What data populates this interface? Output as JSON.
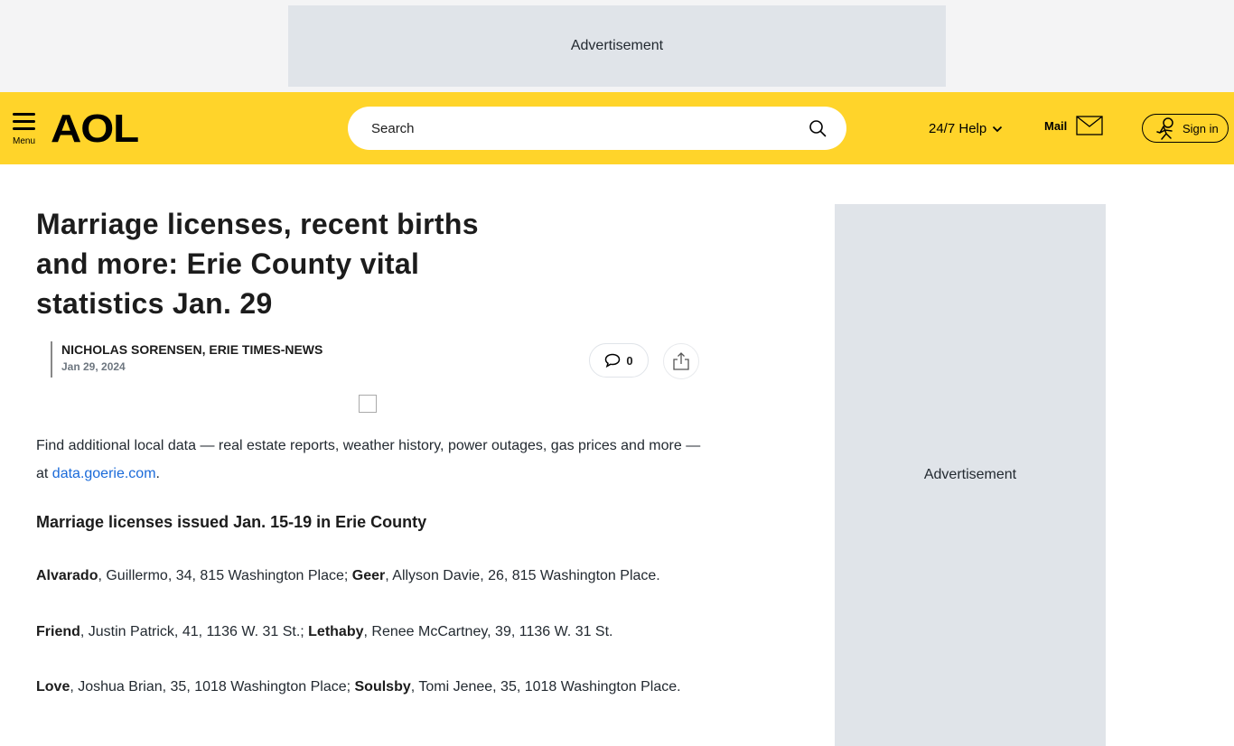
{
  "ads": {
    "top_label": "Advertisement",
    "side_label": "Advertisement"
  },
  "header": {
    "menu_label": "Menu",
    "logo_text": "AOL",
    "search_placeholder": "Search",
    "help_label": "24/7 Help",
    "mail_label": "Mail",
    "signin_label": "Sign in",
    "background_color": "#ffd42a"
  },
  "article": {
    "title": "Marriage licenses, recent births and more: Erie County vital statistics Jan. 29",
    "author": "NICHOLAS SORENSEN, ERIE TIMES-NEWS",
    "date": "Jan 29, 2024",
    "comment_count": "0",
    "intro_before_link": "Find additional local data — real estate reports, weather history, power outages, gas prices and more — at ",
    "intro_link": "data.goerie.com",
    "intro_after_link": ".",
    "subhead": "Marriage licenses issued Jan. 15-19 in Erie County",
    "licenses": [
      {
        "name1": "Alvarado",
        "rest1": ", Guillermo, 34, 815 Washington Place; ",
        "name2": "Geer",
        "rest2": ", Allyson Davie, 26, 815 Washington Place."
      },
      {
        "name1": "Friend",
        "rest1": ", Justin Patrick, 41, 1136 W. 31 St.; ",
        "name2": "Lethaby",
        "rest2": ", Renee McCartney, 39, 1136 W. 31 St."
      },
      {
        "name1": "Love",
        "rest1": ", Joshua Brian, 35, 1018 Washington Place; ",
        "name2": "Soulsby",
        "rest2": ", Tomi Jenee, 35, 1018 Washington Place."
      }
    ]
  }
}
